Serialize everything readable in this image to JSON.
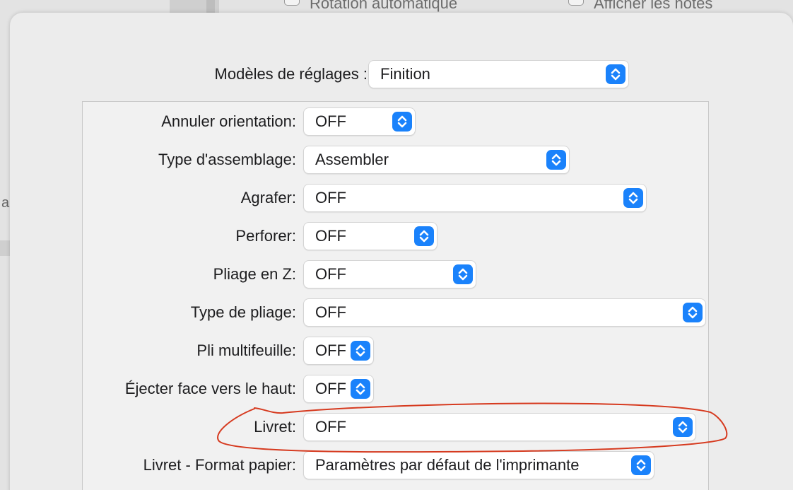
{
  "background": {
    "option1_label": "Rotation automatique",
    "option2_label": "Afficher les notes",
    "side_letter": "a"
  },
  "presets": {
    "label": "Modèles de réglages :",
    "value": "Finition"
  },
  "settings": [
    {
      "label": "Annuler orientation:",
      "value": "OFF"
    },
    {
      "label": "Type d'assemblage:",
      "value": "Assembler"
    },
    {
      "label": "Agrafer:",
      "value": "OFF"
    },
    {
      "label": "Perforer:",
      "value": "OFF"
    },
    {
      "label": "Pliage en Z:",
      "value": "OFF"
    },
    {
      "label": "Type de pliage:",
      "value": "OFF"
    },
    {
      "label": "Pli multifeuille:",
      "value": "OFF"
    },
    {
      "label": "Éjecter face vers le haut:",
      "value": "OFF"
    },
    {
      "label": "Livret:",
      "value": "OFF"
    },
    {
      "label": "Livret - Format papier:",
      "value": "Paramètres par défaut de l'imprimante"
    }
  ],
  "colors": {
    "accent": "#1a82fb",
    "annotation": "#d63a1f"
  },
  "icons": {
    "popup_arrows": "chevron-up-down-icon"
  }
}
